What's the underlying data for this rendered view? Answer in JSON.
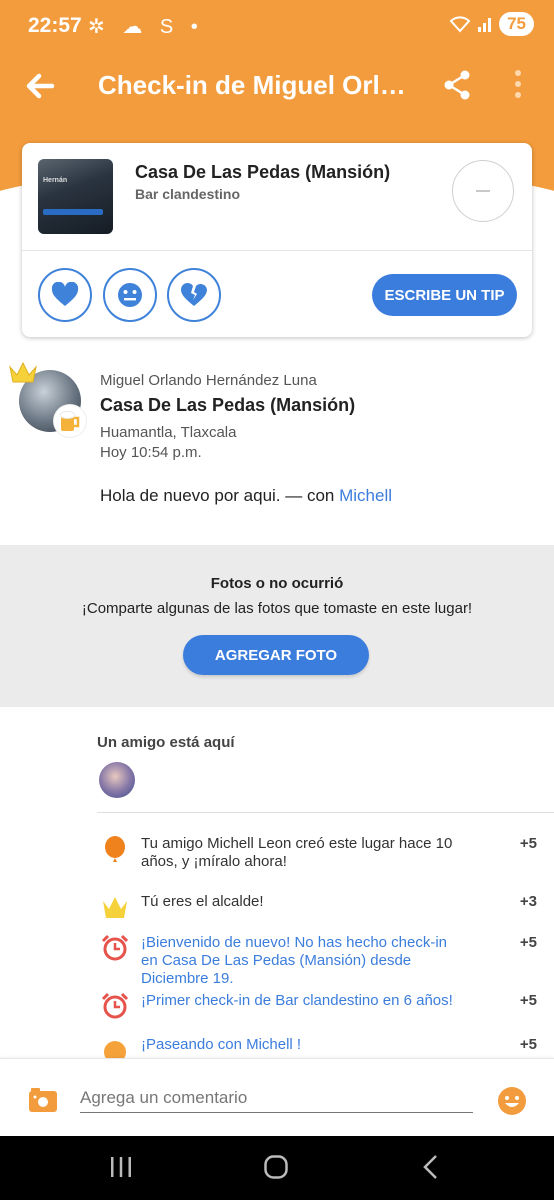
{
  "status": {
    "time": "22:57",
    "icons": "✲ ☁ S •",
    "battery": "75"
  },
  "appbar": {
    "title": "Check-in de Miguel Orlando Hernández Luna"
  },
  "venue": {
    "name": "Casa De Las Pedas (Mansión)",
    "category": "Bar clandestino",
    "thumb_title": "Hernán",
    "tip_label": "ESCRIBE UN TIP"
  },
  "checkin": {
    "user": "Miguel Orlando Hernández Luna",
    "venue": "Casa De Las Pedas (Mansión)",
    "location": "Huamantla, Tlaxcala",
    "time": "Hoy 10:54 p.m.",
    "shout": "Hola de nuevo por aqui. — con",
    "with": "Michell"
  },
  "photos": {
    "title": "Fotos o no ocurrió",
    "subtitle": "¡Comparte algunas de las fotos que tomaste en este lugar!",
    "button": "AGREGAR FOTO"
  },
  "friends": {
    "title": "Un amigo está aquí"
  },
  "rewards": [
    {
      "icon": "balloon-icon",
      "text": "Tu amigo Michell   Leon creó este lugar hace 10 años, y ¡míralo ahora!",
      "points": "+5",
      "link": false
    },
    {
      "icon": "crown-icon",
      "text": "Tú eres el alcalde!",
      "points": "+3",
      "link": false
    },
    {
      "icon": "alarm-clock-icon",
      "text": "¡Bienvenido de nuevo! No has hecho check-in en Casa De Las Pedas (Mansión) desde Diciembre 19.",
      "points": "+5",
      "link": true
    },
    {
      "icon": "alarm-clock-icon",
      "text": "¡Primer check-in de Bar clandestino en 6 años!",
      "points": "+5",
      "link": true
    },
    {
      "icon": "smiley-icon",
      "text": "¡Paseando con Michell  !",
      "points": "+5",
      "link": true
    }
  ],
  "comment": {
    "placeholder": "Agrega un comentario"
  },
  "colors": {
    "brand_orange": "#f39c3d",
    "accent_blue": "#3b7ddd"
  }
}
